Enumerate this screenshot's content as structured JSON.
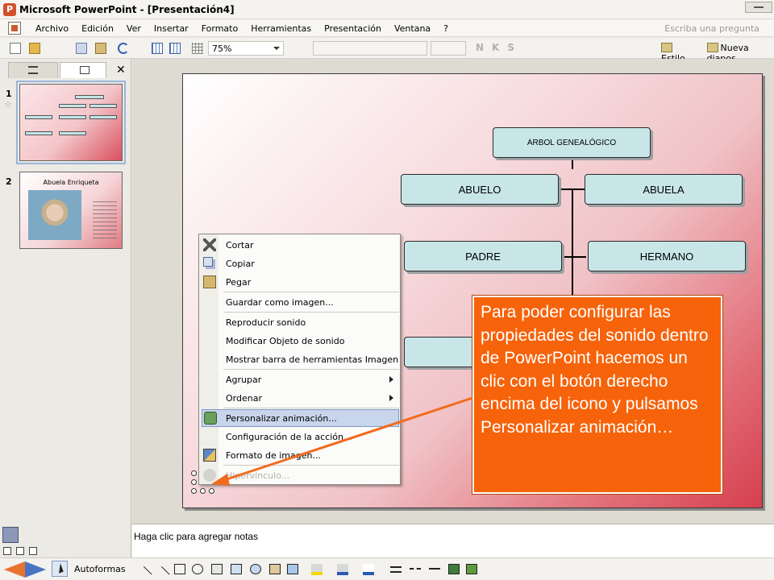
{
  "window": {
    "title": "Microsoft PowerPoint - [Presentación4]"
  },
  "menu": {
    "items": [
      "Archivo",
      "Edición",
      "Ver",
      "Insertar",
      "Formato",
      "Herramientas",
      "Presentación",
      "Ventana",
      "?"
    ],
    "ask_placeholder": "Escriba una pregunta"
  },
  "toolbar": {
    "zoom": "75%",
    "estilo_label": "Estilo",
    "nueva_label": "Nueva diapos"
  },
  "slides_pane": {
    "slide1_number": "1",
    "slide2_number": "2",
    "slide2_title": "Abuela Enriqueta",
    "close_glyph": "✕"
  },
  "slide": {
    "tree": {
      "root": "ARBOL GENEALÓGICO",
      "abuelo": "ABUELO",
      "abuela": "ABUELA",
      "padre": "PADRE",
      "hermano": "HERMANO"
    }
  },
  "context_menu": {
    "cortar": "Cortar",
    "copiar": "Copiar",
    "pegar": "Pegar",
    "guardar_imagen": "Guardar como imagen...",
    "reproducir": "Reproducir sonido",
    "modificar": "Modificar Objeto de sonido",
    "mostrar_barra": "Mostrar barra de herramientas Imagen",
    "agrupar": "Agrupar",
    "ordenar": "Ordenar",
    "personalizar": "Personalizar animación...",
    "configuracion": "Configuración de la acción...",
    "formato_imagen": "Formato de imagen...",
    "hipervinculo": "Hipervínculo..."
  },
  "callout": {
    "text": "Para poder configurar las propiedades del sonido dentro de PowerPoint hacemos un clic con el botón derecho encima del icono y pulsamos Personalizar animación…"
  },
  "notes": {
    "placeholder": "Haga clic para agregar notas"
  },
  "drawing_toolbar": {
    "autoformas": "Autoformas"
  },
  "colors": {
    "callout": "#f6630b",
    "node_fill": "#c8e6e8",
    "highlight": "#c9d5ec",
    "arrow": "#f26b1d"
  }
}
